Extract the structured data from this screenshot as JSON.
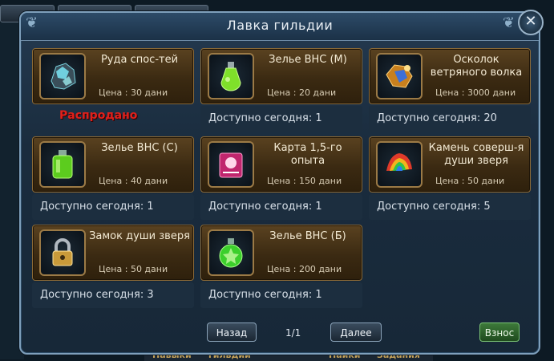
{
  "window": {
    "title": "Лавка гильдии",
    "close_label": "✕"
  },
  "items": [
    {
      "name": "Руда спос-тей",
      "price": "Цена : 30 дани",
      "sold_out": "Распродано",
      "icon": "ore-crystal-icon"
    },
    {
      "name": "Зелье ВНС (М)",
      "price": "Цена : 20 дани",
      "available": "Доступно сегодня:  1",
      "icon": "potion-m-icon"
    },
    {
      "name": "Осколок ветряного волка",
      "price": "Цена : 3000 дани",
      "available": "Доступно сегодня:  20",
      "icon": "wind-wolf-shard-icon"
    },
    {
      "name": "Зелье ВНС (С)",
      "price": "Цена : 40 дани",
      "available": "Доступно сегодня:  1",
      "icon": "potion-s-icon"
    },
    {
      "name": "Карта 1,5-го опыта",
      "price": "Цена : 150 дани",
      "available": "Доступно сегодня:  1",
      "icon": "exp-card-icon"
    },
    {
      "name": "Камень соверш-я души зверя",
      "price": "Цена : 50 дани",
      "available": "Доступно сегодня:  5",
      "icon": "beast-soul-stone-icon"
    },
    {
      "name": "Замок души зверя",
      "price": "Цена : 50 дани",
      "available": "Доступно сегодня:  3",
      "icon": "beast-soul-lock-icon"
    },
    {
      "name": "Зелье ВНС (Б)",
      "price": "Цена : 200 дани",
      "available": "Доступно сегодня:  1",
      "icon": "potion-b-icon"
    }
  ],
  "footer": {
    "prev_label": "Назад",
    "page_indicator": "1/1",
    "next_label": "Далее",
    "contribute_label": "Взнос"
  },
  "background": {
    "bottom_labels": [
      "Навыки",
      "гильдии",
      "Пайки",
      "Задания"
    ]
  },
  "colors": {
    "card": "#3b2a12",
    "window": "#1a2c3e",
    "sold_out": "#e0201b",
    "contribute": "#3d7a3a"
  }
}
